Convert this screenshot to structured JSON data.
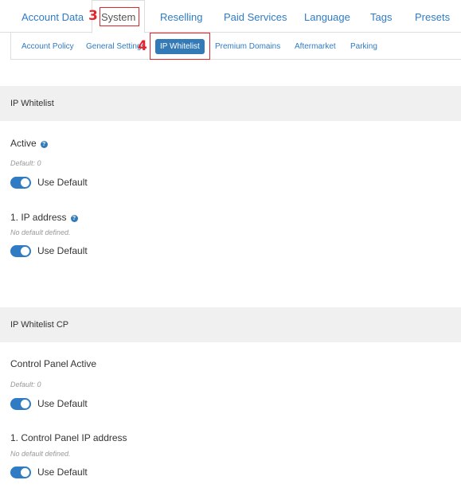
{
  "top_tabs": [
    {
      "label": "Account Data"
    },
    {
      "label": "System"
    },
    {
      "label": "Reselling"
    },
    {
      "label": "Paid Services"
    },
    {
      "label": "Language"
    },
    {
      "label": "Tags"
    },
    {
      "label": "Presets"
    }
  ],
  "sub_tabs": [
    {
      "label": "Account Policy"
    },
    {
      "label": "General Settings"
    },
    {
      "label": "IP Whitelist"
    },
    {
      "label": "Premium Domains"
    },
    {
      "label": "Aftermarket"
    },
    {
      "label": "Parking"
    }
  ],
  "annotations": {
    "system": "3",
    "ip_whitelist": "4"
  },
  "sections": [
    {
      "title": "IP Whitelist",
      "fields": [
        {
          "label": "Active",
          "help": "?",
          "default": "Default: 0",
          "toggle_label": "Use Default",
          "toggle_on": true
        },
        {
          "label": "1. IP address",
          "help": "?",
          "default": "No default defined.",
          "toggle_label": "Use Default",
          "toggle_on": true
        }
      ]
    },
    {
      "title": "IP Whitelist CP",
      "fields": [
        {
          "label": "Control Panel Active",
          "default": "Default: 0",
          "toggle_label": "Use Default",
          "toggle_on": true
        },
        {
          "label": "1. Control Panel IP address",
          "default": "No default defined.",
          "toggle_label": "Use Default",
          "toggle_on": true
        }
      ]
    }
  ],
  "colors": {
    "link": "#2f7bc4",
    "accent": "#337ab7",
    "annotation": "#e3242b",
    "section_bg": "#f0f0f0"
  }
}
